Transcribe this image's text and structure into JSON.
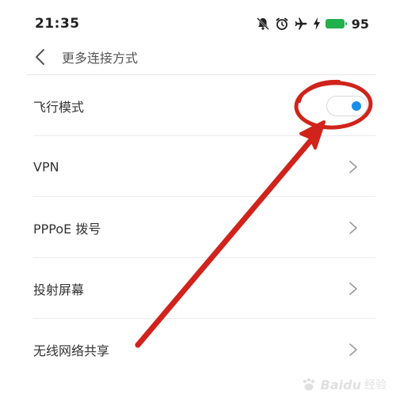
{
  "status_bar": {
    "time": "21:35",
    "icons": [
      "mute-icon",
      "alarm-icon",
      "airplane-icon",
      "charging-icon",
      "battery-icon"
    ],
    "battery_level": "95",
    "battery_color": "#22b14c"
  },
  "header": {
    "back_icon": "chevron-left-icon",
    "title": "更多连接方式"
  },
  "items": [
    {
      "label": "飞行模式",
      "control": "toggle",
      "toggle_on": true
    },
    {
      "label": "VPN",
      "control": "chevron"
    },
    {
      "label": "PPPoE 拨号",
      "control": "chevron"
    },
    {
      "label": "投射屏幕",
      "control": "chevron"
    },
    {
      "label": "无线网络共享",
      "control": "chevron"
    }
  ],
  "colors": {
    "accent": "#1a8fea",
    "annotation": "#d0231b"
  },
  "watermark": {
    "brand": "Baidu",
    "sub": "经验"
  }
}
